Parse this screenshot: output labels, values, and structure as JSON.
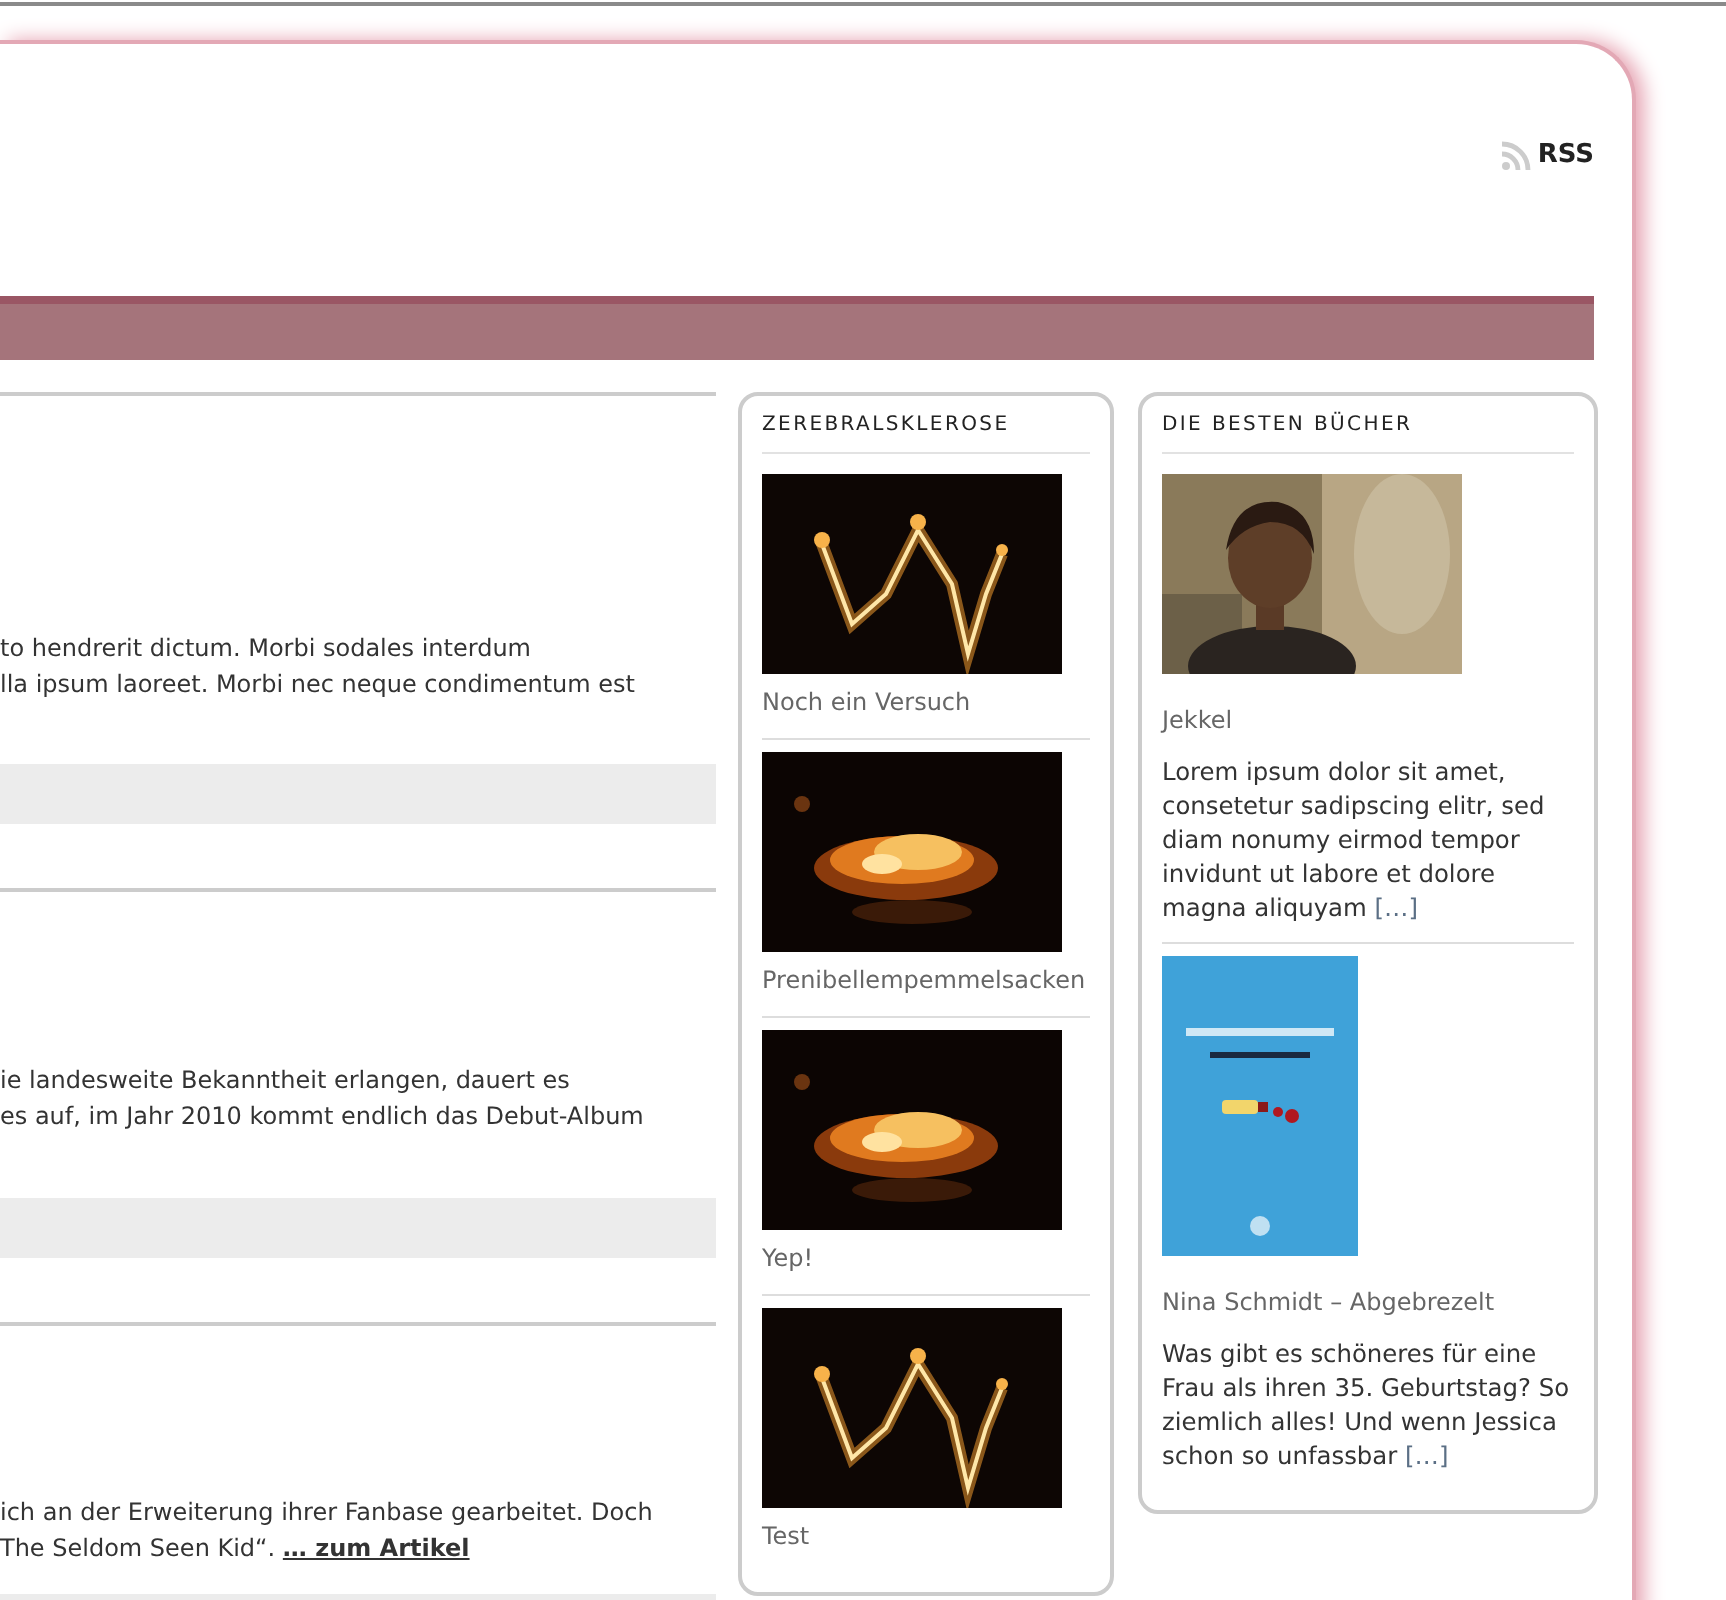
{
  "header": {
    "rss": "RSS"
  },
  "posts": [
    {
      "lines": [
        "to hendrerit dictum. Morbi sodales interdum",
        "lla ipsum laoreet. Morbi nec neque condimentum est"
      ]
    },
    {
      "lines": [
        "ie landesweite Bekanntheit erlangen, dauert es",
        "es auf, im Jahr 2010 kommt endlich das Debut-Album"
      ]
    },
    {
      "lines": [
        "ich an der Erweiterung ihrer Fanbase gearbeitet. Doch",
        "The Seldom Seen Kid“."
      ],
      "more": "… zum Artikel"
    }
  ],
  "widgets": [
    {
      "title": "ZEREBRALSKLEROSE",
      "items": [
        {
          "caption": "Noch ein Versuch"
        },
        {
          "caption": "Prenibellempemmelsacken"
        },
        {
          "caption": "Yep!"
        },
        {
          "caption": "Test"
        }
      ]
    },
    {
      "title": "DIE BESTEN BÜCHER",
      "items": [
        {
          "caption": "Jekkel",
          "text": "Lorem ipsum dolor sit amet, consetetur sadipscing elitr, sed diam nonumy eirmod tempor invidunt ut labore et dolore magna aliquyam",
          "more": "[…]"
        },
        {
          "caption": "Nina Schmidt – Abgebrezelt",
          "text": "Was gibt es schöneres für eine Frau als ihren 35. Geburtstag? So ziemlich alles! Und wenn Jessica schon so unfassbar",
          "more": "[…]"
        }
      ]
    }
  ]
}
